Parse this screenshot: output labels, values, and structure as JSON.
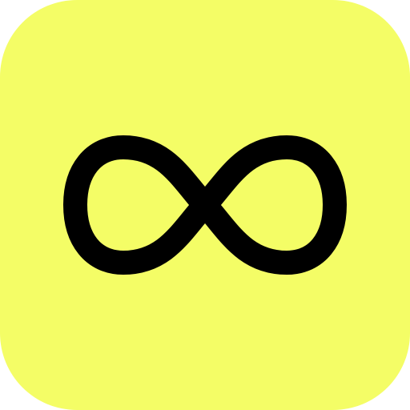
{
  "app_icon": {
    "background_color": "#f4fd66",
    "glyph": "infinity-icon",
    "glyph_color": "#000000"
  }
}
